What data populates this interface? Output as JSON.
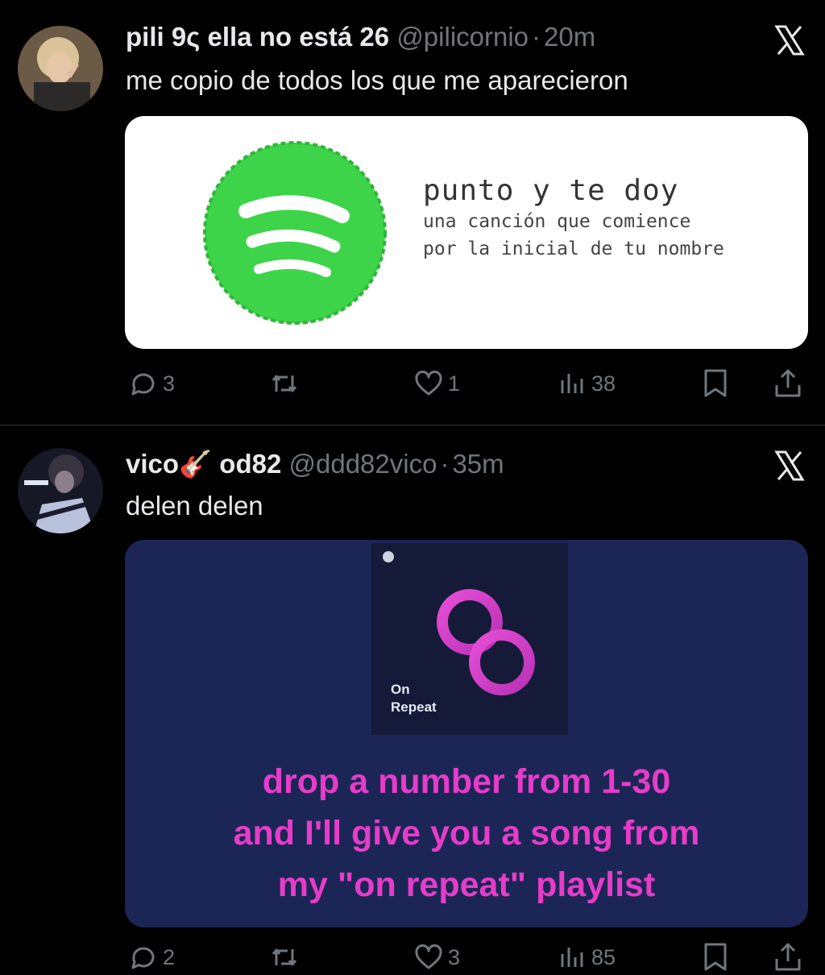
{
  "tweets": [
    {
      "name": "pili ♉︎ ella no está 26",
      "name_display": "pili 9ς ella no está 26",
      "handle": "@pilicornio",
      "separator": "·",
      "time": "20m",
      "text": "me copio de todos los que me aparecieron",
      "image": {
        "line1": "punto y te doy",
        "line2": "una canción que comience",
        "line3": "por la inicial de tu nombre"
      },
      "replies": "3",
      "retweets": "",
      "likes": "1",
      "views": "38"
    },
    {
      "name": "vico🎸",
      "name_suffix": "od82",
      "handle": "@ddd82vico",
      "separator": "·",
      "time": "35m",
      "text": "delen delen",
      "image": {
        "tile_label_1": "On",
        "tile_label_2": "Repeat",
        "caption1": "drop a number from 1-30",
        "caption2": "and I'll give you a song from",
        "caption3": "my \"on repeat\" playlist"
      },
      "replies": "2",
      "retweets": "",
      "likes": "3",
      "views": "85"
    }
  ],
  "colors": {
    "background": "#000000",
    "text": "#e7e9ea",
    "muted": "#71767b",
    "divider": "#2f3336",
    "spotify_green": "#3dd44a",
    "on_repeat_pink": "#e63cc8",
    "on_repeat_bg": "#1c2656"
  }
}
